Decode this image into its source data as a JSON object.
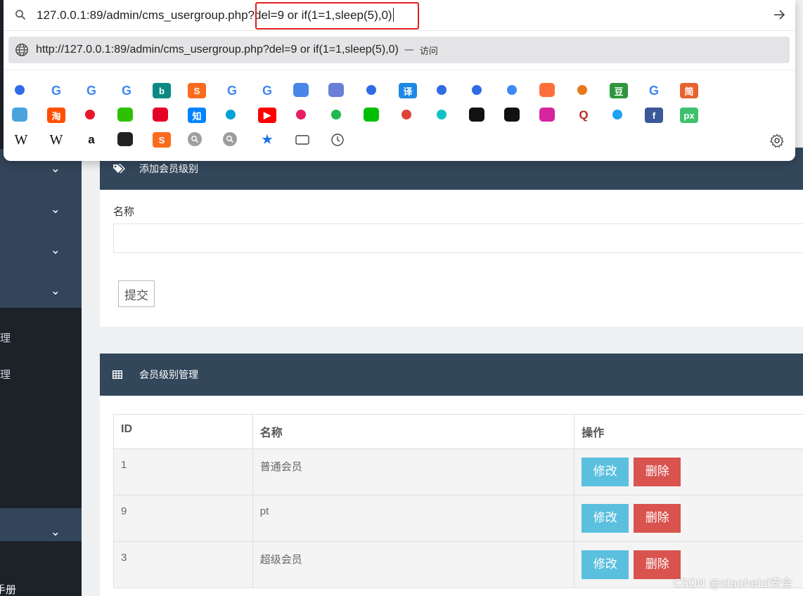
{
  "browser": {
    "address_base": "127.0.0.1:89/admin/cms_usergroup.php",
    "address_query": "?del=9 or if(1=1,sleep(5),0)",
    "suggestion": {
      "url": "http://127.0.0.1:89/admin/cms_usergroup.php?del=9 or if(1=1,sleep(5),0)",
      "separator": "—",
      "action": "访问"
    },
    "quick_links": [
      [
        "baidu-paw-icon",
        "google-icon",
        "google-icon",
        "google-icon",
        "bing-icon",
        "sogou-icon",
        "google-icon",
        "google-icon",
        "google-translate-icon",
        "database-icon",
        "baidu-paw-icon",
        "translate-yi-icon",
        "baidu-paw-icon",
        "baidu-paw-icon",
        "cloud-icon",
        "fire-icon",
        "exchange-icon",
        "douban-icon",
        "google-icon",
        "jian-icon"
      ],
      [
        "dictionary-icon",
        "taobao-icon",
        "weibo-icon",
        "wechat-icon",
        "netease-music-icon",
        "zhihu-icon",
        "bilibili-icon",
        "youtube-icon",
        "youku-icon",
        "tencent-video-icon",
        "iqiyi-icon",
        "chrome-icon",
        "puzzle-icon",
        "github-icon",
        "feather-icon",
        "instagram-icon",
        "quora-icon",
        "twitter-icon",
        "facebook-icon",
        "pixiv-icon"
      ],
      [
        "wikipedia-icon",
        "wikipedia-icon",
        "amazon-icon",
        "terminal-icon",
        "sogou-icon",
        "search-gray-icon",
        "search-gray-icon",
        "star-icon",
        "window-icon",
        "clock-icon"
      ]
    ],
    "quick_glyphs": {
      "google-icon": "G",
      "wikipedia-icon": "W",
      "amazon-icon": "a",
      "zhihu-icon": "知",
      "douban-icon": "豆",
      "jian-icon": "简",
      "translate-yi-icon": "译",
      "taobao-icon": "淘",
      "quora-icon": "Q",
      "facebook-icon": "f",
      "pixiv-icon": "px",
      "bing-icon": "b",
      "sogou-icon": "S",
      "youtube-icon": "▶",
      "star-icon": "★"
    }
  },
  "page": {
    "add_panel_title": "添加会员级别",
    "name_label": "名称",
    "submit_label": "提交",
    "manage_panel_title": "会员级别管理",
    "table": {
      "headers": [
        "ID",
        "名称",
        "操作"
      ],
      "rows": [
        {
          "id": "1",
          "name": "普通会员"
        },
        {
          "id": "9",
          "name": "pt"
        },
        {
          "id": "3",
          "name": "超级会员"
        }
      ],
      "edit_label": "修改",
      "delete_label": "删除"
    },
    "sidebar_fragments": [
      "理",
      "理",
      "手册"
    ]
  },
  "watermark": "CSDN @xiaoheizi安全",
  "colors": {
    "sidebar_dark": "#1d2229",
    "sidebar_group": "#33455a",
    "panel_header": "#33475b",
    "edit_button": "#5bc0de",
    "delete_button": "#d9534f",
    "highlight_box": "#e02020"
  }
}
